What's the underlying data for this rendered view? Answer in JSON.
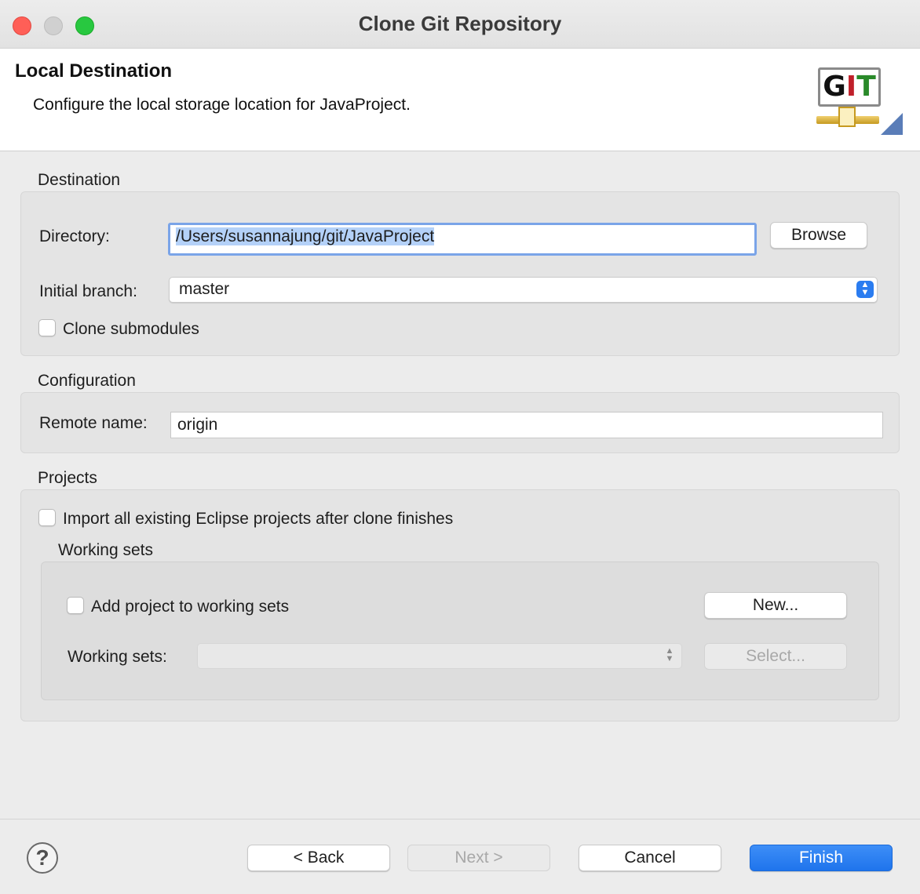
{
  "window": {
    "title": "Clone Git Repository"
  },
  "header": {
    "title": "Local Destination",
    "description": "Configure the local storage location for JavaProject.",
    "logo": {
      "letters": [
        "G",
        "I",
        "T"
      ],
      "icon": "git-wizard-icon"
    }
  },
  "destination": {
    "section_label": "Destination",
    "directory_label": "Directory:",
    "directory_value": "/Users/susannajung/git/JavaProject",
    "browse_label": "Browse",
    "branch_label": "Initial branch:",
    "branch_value": "master",
    "clone_submodules_label": "Clone submodules",
    "clone_submodules_checked": false
  },
  "configuration": {
    "section_label": "Configuration",
    "remote_label": "Remote name:",
    "remote_value": "origin"
  },
  "projects": {
    "section_label": "Projects",
    "import_label": "Import all existing Eclipse projects after clone finishes",
    "import_checked": false,
    "working_sets": {
      "section_label": "Working sets",
      "add_label": "Add project to working sets",
      "add_checked": false,
      "new_label": "New...",
      "sets_label": "Working sets:",
      "sets_value": "",
      "select_label": "Select..."
    }
  },
  "footer": {
    "help_symbol": "?",
    "back_label": "< Back",
    "next_label": "Next >",
    "cancel_label": "Cancel",
    "finish_label": "Finish"
  },
  "colors": {
    "accent": "#2a7cf0",
    "selection": "#b4d1f8",
    "focus_ring": "#7aa4e8",
    "close": "#ff5f57",
    "zoom": "#28c840"
  }
}
